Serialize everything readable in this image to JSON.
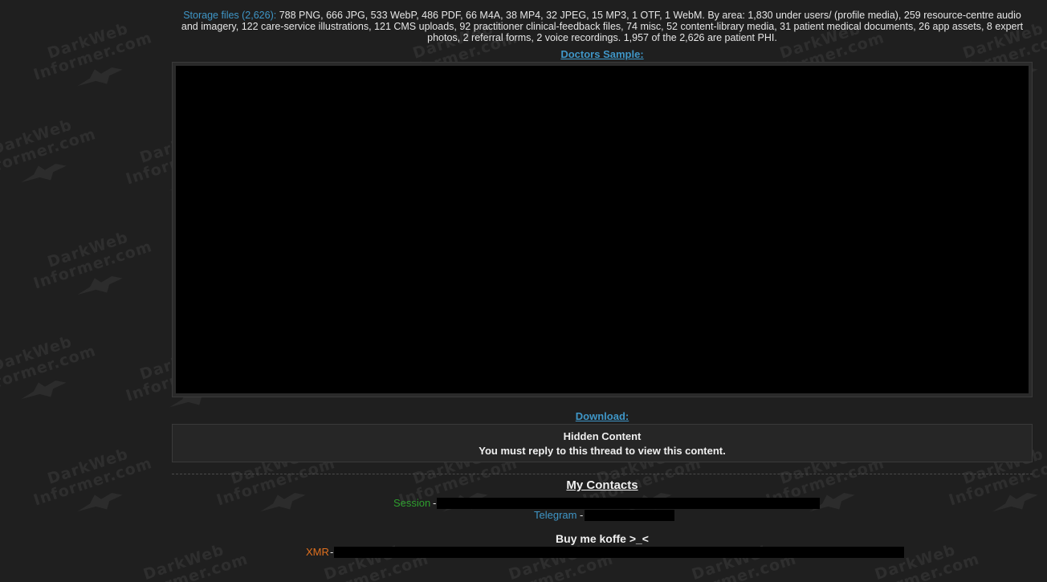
{
  "storage": {
    "label": "Storage files (2,626):",
    "text": "788 PNG, 666 JPG, 533 WebP, 486 PDF, 66 M4A, 38 MP4, 32 JPEG, 15 MP3, 1 OTF, 1 WebM. By area: 1,830 under users/ (profile media), 259 resource-centre audio and imagery, 122 care-service illustrations, 121 CMS uploads, 92 practitioner clinical-feedback files, 74 misc, 52 content-library media, 31 patient medical documents, 26 app assets, 8 expert photos, 2 referral forms, 2 voice recordings. 1,957 of the 2,626 are patient PHI."
  },
  "sample": {
    "link_label": "Doctors Sample:"
  },
  "download": {
    "link_label": "Download:",
    "hidden_title": "Hidden Content",
    "hidden_message": "You must reply to this thread to view this content."
  },
  "contacts": {
    "title": "My Contacts",
    "session_label": "Session",
    "telegram_label": "Telegram",
    "separator": "-"
  },
  "donate": {
    "title": "Buy me koffe >_<",
    "xmr_label": "XMR",
    "separator": "-"
  },
  "watermark": {
    "line1": "DarkWeb",
    "line2": "Informer.com"
  },
  "colors": {
    "background": "#1f1f1f",
    "link": "#3f96c7",
    "session": "#2e9e2e",
    "xmr": "#e0701f"
  }
}
